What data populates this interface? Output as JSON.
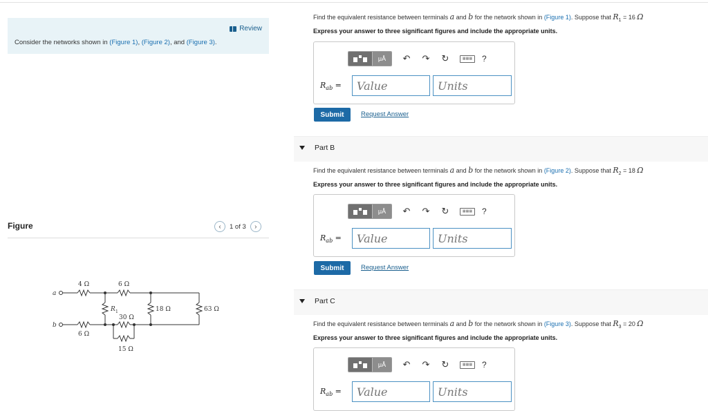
{
  "left": {
    "review": "Review",
    "consider_prefix": "Consider the networks shown in ",
    "fig1": "(Figure 1)",
    "fig2": "(Figure 2)",
    "fig3": "(Figure 3)",
    "sep1": ", ",
    "sep2": ", and ",
    "end": ".",
    "figure_title": "Figure",
    "figure_page": "1 of 3"
  },
  "circuit": {
    "node_a": "a",
    "node_b": "b",
    "r_4": "4 Ω",
    "r_6top": "6 Ω",
    "r_6bot": "6 Ω",
    "r_R1": "R",
    "r_R1_sub": "1",
    "r_30": "30 Ω",
    "r_18": "18 Ω",
    "r_63": "63 Ω",
    "r_15": "15 Ω"
  },
  "partA": {
    "text_prefix": "Find the equivalent resistance between terminals ",
    "a": "a",
    "and": " and ",
    "b": "b",
    "for": " for the network shown in ",
    "fig": "(Figure 1)",
    "suppose": ". Suppose that ",
    "R": "R",
    "R_sub": "1",
    "eq": " = 16 ",
    "unit": "Ω",
    "instr": "Express your answer to three significant figures and include the appropriate units."
  },
  "partB": {
    "label": "Part B",
    "fig": "(Figure 2)",
    "R_sub": "2",
    "eq": " = 18 "
  },
  "partC": {
    "label": "Part C",
    "fig": "(Figure 3)",
    "R_sub": "3",
    "eq": " = 20 "
  },
  "answer": {
    "R_label": "R",
    "R_sub": "ab",
    "equals": " =",
    "value_placeholder": "Value",
    "units_placeholder": "Units",
    "mu": "μÅ",
    "help": "?",
    "submit": "Submit",
    "request": "Request Answer"
  }
}
